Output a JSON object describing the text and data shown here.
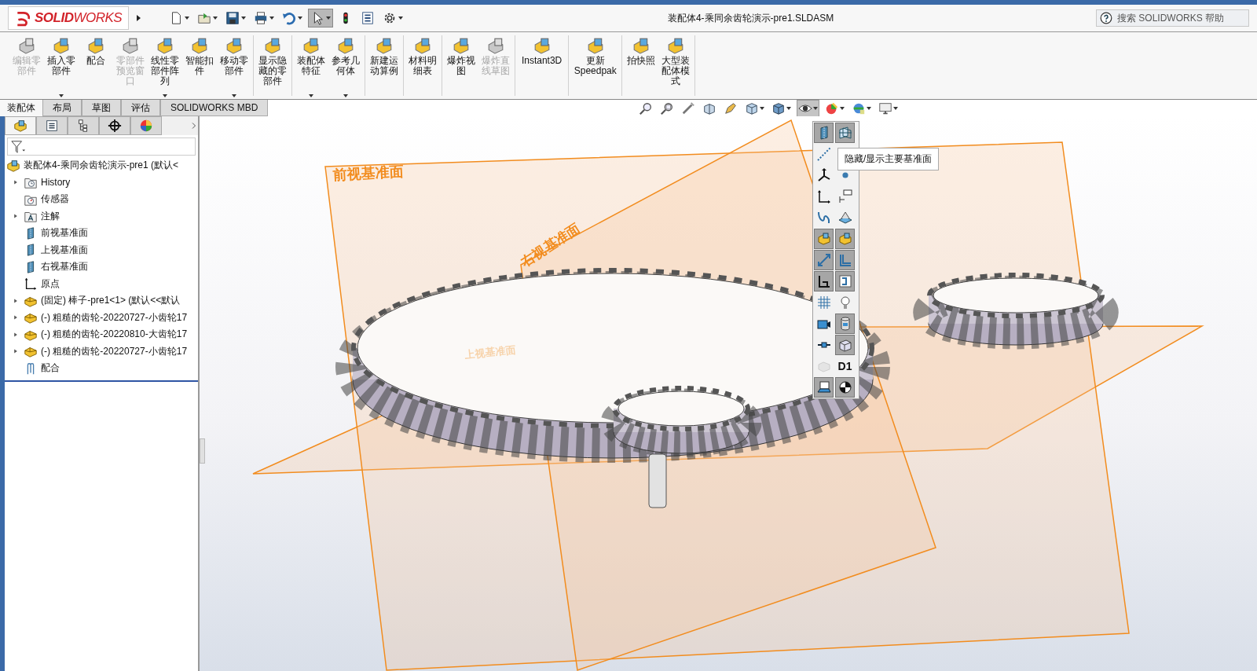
{
  "app": {
    "logo": "**SOLID**WORKS",
    "title": "装配体4-乘同余齿轮演示-pre1.SLDASM",
    "help_search": {
      "placeholder": "搜索 SOLIDWORKS 帮助"
    }
  },
  "quick_access": [
    {
      "kind": "new",
      "selected": false
    },
    {
      "kind": "open",
      "selected": false
    },
    {
      "kind": "save",
      "selected": false
    },
    {
      "kind": "print",
      "selected": false
    },
    {
      "kind": "undo",
      "selected": false
    },
    {
      "kind": "select",
      "selected": true
    },
    {
      "kind": "rebuild",
      "selected": false
    },
    {
      "kind": "file-props",
      "selected": false
    },
    {
      "kind": "options",
      "selected": false
    }
  ],
  "ribbon": [
    [
      {
        "label": "编辑零部件",
        "disabled": true,
        "dropdown": false
      },
      {
        "label": "插入零部件",
        "disabled": false,
        "dropdown": true
      },
      {
        "label": "配合",
        "disabled": false,
        "dropdown": false
      },
      {
        "label": "零部件预览窗口",
        "disabled": true,
        "dropdown": false
      },
      {
        "label": "线性零部件阵列",
        "disabled": false,
        "dropdown": true
      },
      {
        "label": "智能扣件",
        "disabled": false,
        "dropdown": false
      },
      {
        "label": "移动零部件",
        "disabled": false,
        "dropdown": true
      }
    ],
    [
      {
        "label": "显示隐藏的零部件",
        "disabled": false,
        "dropdown": false
      }
    ],
    [
      {
        "label": "装配体特征",
        "disabled": false,
        "dropdown": true
      },
      {
        "label": "参考几何体",
        "disabled": false,
        "dropdown": true
      }
    ],
    [
      {
        "label": "新建运动算例",
        "disabled": false,
        "dropdown": false
      }
    ],
    [
      {
        "label": "材料明细表",
        "disabled": false,
        "dropdown": false
      }
    ],
    [
      {
        "label": "爆炸视图",
        "disabled": false,
        "dropdown": false
      },
      {
        "label": "爆炸直线草图",
        "disabled": true,
        "dropdown": false
      }
    ],
    [
      {
        "label": "Instant3D",
        "disabled": false,
        "dropdown": false
      }
    ],
    [
      {
        "label": "更新 Speedpak",
        "disabled": false,
        "dropdown": false
      }
    ],
    [
      {
        "label": "拍快照",
        "disabled": false,
        "dropdown": false
      },
      {
        "label": "大型装配体模式",
        "disabled": false,
        "dropdown": false
      }
    ]
  ],
  "tabs": [
    {
      "label": "装配体",
      "selected": true
    },
    {
      "label": "布局",
      "selected": false
    },
    {
      "label": "草图",
      "selected": false
    },
    {
      "label": "评估",
      "selected": false
    },
    {
      "label": "SOLIDWORKS MBD",
      "selected": false
    }
  ],
  "view_toolbar": [
    {
      "kind": "zoom-fit",
      "selected": false,
      "dropdown": false
    },
    {
      "kind": "zoom-area",
      "selected": false,
      "dropdown": false
    },
    {
      "kind": "previous",
      "selected": false,
      "dropdown": false
    },
    {
      "kind": "section",
      "selected": false,
      "dropdown": false
    },
    {
      "kind": "annotation",
      "selected": false,
      "dropdown": false
    },
    {
      "kind": "orientation",
      "selected": false,
      "dropdown": true
    },
    {
      "kind": "display-style",
      "selected": false,
      "dropdown": true
    },
    {
      "kind": "hide-show",
      "selected": true,
      "dropdown": true
    },
    {
      "kind": "appearance",
      "selected": false,
      "dropdown": true
    },
    {
      "kind": "scene",
      "selected": false,
      "dropdown": true
    },
    {
      "kind": "monitor",
      "selected": false,
      "dropdown": true
    }
  ],
  "panel_tabs": [
    {
      "kind": "feature-tree",
      "selected": true
    },
    {
      "kind": "property",
      "selected": false
    },
    {
      "kind": "config",
      "selected": false
    },
    {
      "kind": "dimxpert",
      "selected": false
    },
    {
      "kind": "display",
      "selected": false
    }
  ],
  "tree": {
    "root": {
      "label": "装配体4-乘同余齿轮演示-pre1  (默认<",
      "children": [
        {
          "kind": "history",
          "label": "History",
          "expander": true
        },
        {
          "kind": "sensor",
          "label": "传感器",
          "expander": false
        },
        {
          "kind": "annotation",
          "label": "注解",
          "expander": true
        },
        {
          "kind": "plane",
          "label": "前视基准面",
          "expander": false
        },
        {
          "kind": "plane",
          "label": "上视基准面",
          "expander": false
        },
        {
          "kind": "plane",
          "label": "右视基准面",
          "expander": false
        },
        {
          "kind": "origin",
          "label": "原点",
          "expander": false
        },
        {
          "kind": "part",
          "label": "(固定) 棒子-pre1<1> (默认<<默认",
          "expander": true
        },
        {
          "kind": "part",
          "label": "(-) 粗糙的齿轮-20220727-小齿轮17",
          "expander": true
        },
        {
          "kind": "part",
          "label": "(-) 粗糙的齿轮-20220810-大齿轮17",
          "expander": true
        },
        {
          "kind": "part",
          "label": "(-) 粗糙的齿轮-20220727-小齿轮17",
          "expander": true
        },
        {
          "kind": "mates",
          "label": "配合",
          "expander": false
        }
      ]
    }
  },
  "viewport": {
    "plane_labels": [
      {
        "kind": "front",
        "label": "前视基准面"
      },
      {
        "kind": "right",
        "label": "右视基准面"
      },
      {
        "kind": "top",
        "label": "上视基准面"
      }
    ],
    "palette": [
      [
        {
          "kind": "plane",
          "on": true
        },
        {
          "kind": "planes",
          "on": true
        }
      ],
      [
        {
          "kind": "axis",
          "on": false
        }
      ],
      [
        {
          "kind": "axes",
          "on": false
        },
        {
          "kind": "point",
          "on": false
        }
      ],
      [
        {
          "kind": "origin",
          "on": false
        },
        {
          "kind": "label",
          "on": false
        }
      ],
      [
        {
          "kind": "curve",
          "on": false
        },
        {
          "kind": "surface",
          "on": false
        }
      ],
      [
        {
          "kind": "parts-label",
          "on": true
        },
        {
          "kind": "parts-label",
          "on": true
        }
      ],
      [
        {
          "kind": "dimension",
          "on": true
        },
        {
          "kind": "corner",
          "on": true
        }
      ],
      [
        {
          "kind": "sketch",
          "on": true
        },
        {
          "kind": "sketch-3d",
          "on": true
        }
      ],
      [
        {
          "kind": "grid",
          "on": false
        },
        {
          "kind": "bulb",
          "on": false
        }
      ],
      [
        {
          "kind": "camera",
          "on": false
        },
        {
          "kind": "cylinder",
          "on": true
        }
      ],
      [
        {
          "kind": "connector",
          "on": false
        },
        {
          "kind": "box",
          "on": true
        }
      ],
      [
        {
          "kind": "parts",
          "on": false,
          "disabled": true
        },
        {
          "kind": "text",
          "label": "D1",
          "on": false
        }
      ],
      [
        {
          "kind": "laptop",
          "on": true
        },
        {
          "kind": "center",
          "on": true
        }
      ]
    ],
    "tooltip": "隐藏/显示主要基准面"
  }
}
